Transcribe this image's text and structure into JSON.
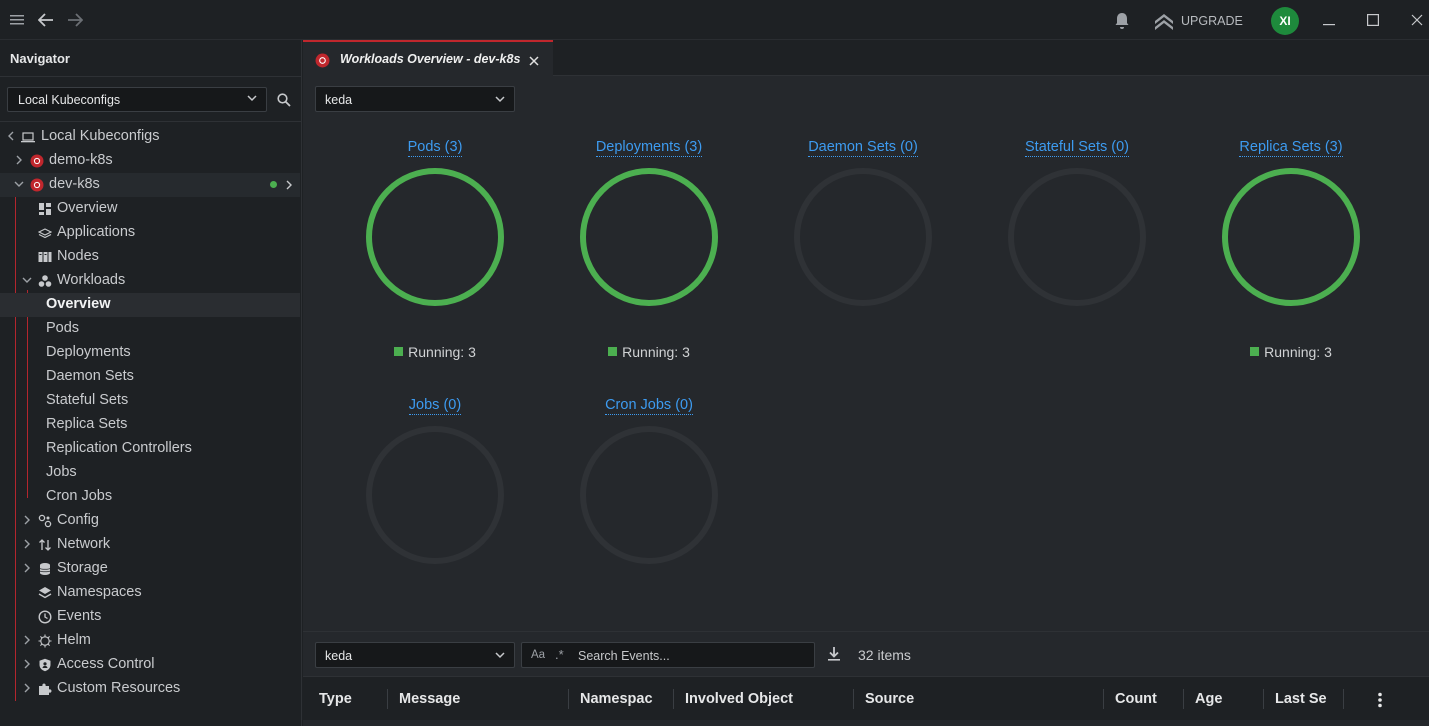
{
  "topbar": {
    "upgrade_label": "UPGRADE",
    "avatar_initials": "XI",
    "avatar_color": "#1e8a3c"
  },
  "sidebar": {
    "tab_label": "Navigator",
    "context_select_value": "Local Kubeconfigs",
    "tree": [
      {
        "label": "Local Kubeconfigs",
        "icon": "laptop-icon"
      },
      {
        "label": "demo-k8s",
        "icon": "kubernetes-icon"
      },
      {
        "label": "dev-k8s",
        "icon": "kubernetes-icon"
      },
      {
        "label": "Overview",
        "icon": "dashboard-icon"
      },
      {
        "label": "Applications",
        "icon": "layers-icon"
      },
      {
        "label": "Nodes",
        "icon": "nodes-icon"
      },
      {
        "label": "Workloads",
        "icon": "workloads-icon"
      },
      {
        "label": "Overview"
      },
      {
        "label": "Pods"
      },
      {
        "label": "Deployments"
      },
      {
        "label": "Daemon Sets"
      },
      {
        "label": "Stateful Sets"
      },
      {
        "label": "Replica Sets"
      },
      {
        "label": "Replication Controllers"
      },
      {
        "label": "Jobs"
      },
      {
        "label": "Cron Jobs"
      },
      {
        "label": "Config",
        "icon": "config-icon"
      },
      {
        "label": "Network",
        "icon": "network-icon"
      },
      {
        "label": "Storage",
        "icon": "storage-icon"
      },
      {
        "label": "Namespaces",
        "icon": "namespaces-icon"
      },
      {
        "label": "Events",
        "icon": "clock-icon"
      },
      {
        "label": "Helm",
        "icon": "helm-icon"
      },
      {
        "label": "Access Control",
        "icon": "shield-icon"
      },
      {
        "label": "Custom Resources",
        "icon": "puzzle-icon"
      }
    ]
  },
  "main": {
    "tab_title": "Workloads Overview - dev-k8s",
    "namespace_value": "keda",
    "workloads": [
      {
        "title": "Pods (3)",
        "running": 3,
        "legend": "Running: 3"
      },
      {
        "title": "Deployments (3)",
        "running": 3,
        "legend": "Running: 3"
      },
      {
        "title": "Daemon Sets (0)",
        "running": 0,
        "legend": ""
      },
      {
        "title": "Stateful Sets (0)",
        "running": 0,
        "legend": ""
      },
      {
        "title": "Replica Sets (3)",
        "running": 3,
        "legend": "Running: 3"
      },
      {
        "title": "Jobs (0)",
        "running": 0,
        "legend": ""
      },
      {
        "title": "Cron Jobs (0)",
        "running": 0,
        "legend": ""
      }
    ],
    "colors": {
      "running": "#4caf50",
      "empty": "#2f3236",
      "link": "#3d9bf0",
      "accent": "#c0272d"
    }
  },
  "events": {
    "namespace_value": "keda",
    "search_placeholder": "Search Events...",
    "case_toggle": "Aa",
    "regex_toggle": ".*",
    "items_count": "32 items",
    "columns": [
      "Type",
      "Message",
      "Namespac",
      "Involved Object",
      "Source",
      "Count",
      "Age",
      "Last Se"
    ]
  }
}
